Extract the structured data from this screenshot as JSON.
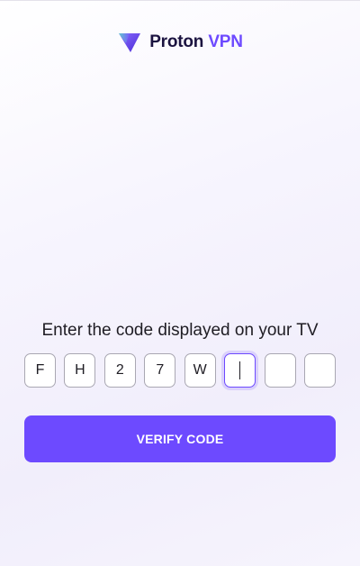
{
  "brand": {
    "name": "Proton",
    "product": "VPN"
  },
  "icons": {
    "logo": "proton-vpn-logo-icon"
  },
  "colors": {
    "accent": "#6d4aff",
    "brand_dark": "#1b1340"
  },
  "prompt": "Enter the code displayed on your TV",
  "code": {
    "length": 8,
    "values": [
      "F",
      "H",
      "2",
      "7",
      "W",
      "",
      "",
      ""
    ],
    "active_index": 5
  },
  "verify_button": "VERIFY CODE"
}
